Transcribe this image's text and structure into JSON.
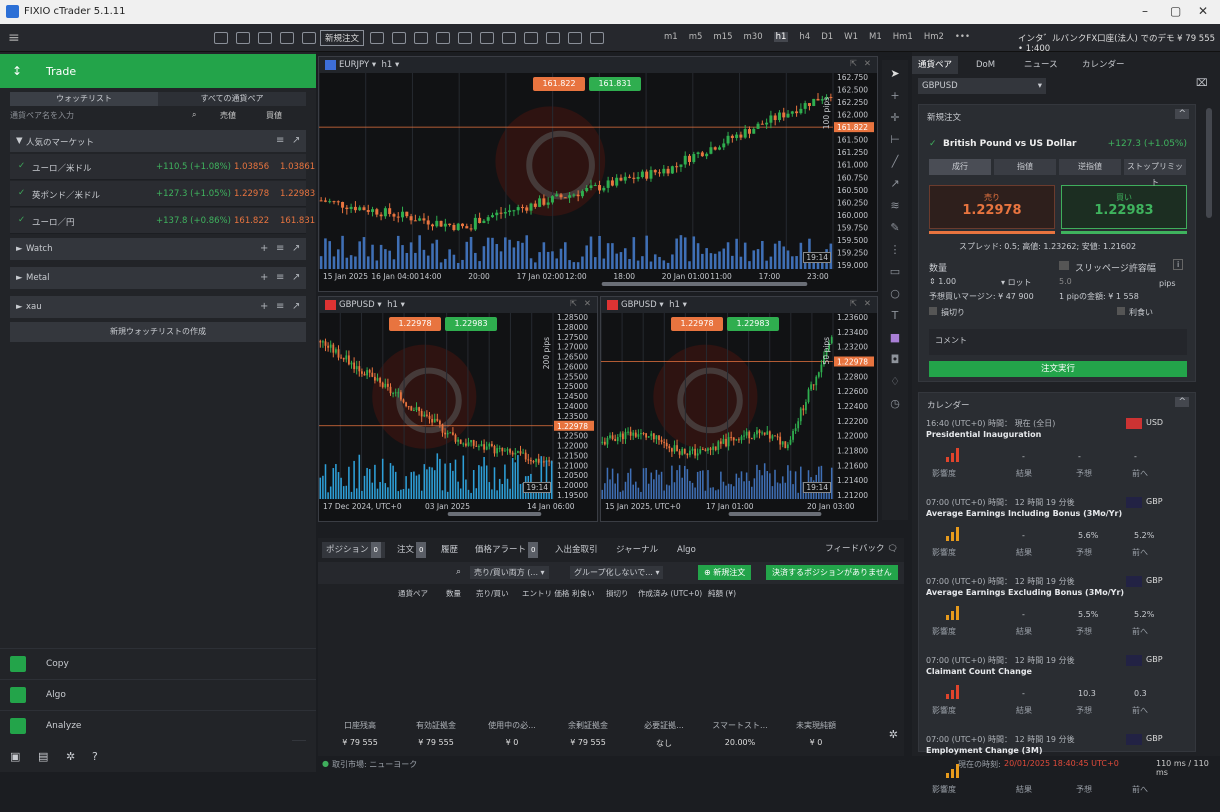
{
  "window": {
    "title": "FIXIO cTrader 5.1.11"
  },
  "toolbar": {
    "new_order": "新規注文",
    "timeframes": [
      "m1",
      "m5",
      "m15",
      "m30",
      "h1",
      "h4",
      "D1",
      "W1",
      "M1",
      "Hm1",
      "Hm2",
      "•••"
    ],
    "account_info": "インタ゛ルバンクFX口座(法人) でのデモ   ¥ 79 555 • 1:400"
  },
  "sidebar": {
    "trade_label": "Trade",
    "tabs": [
      "ウォッチリスト",
      "すべての通貨ペア"
    ],
    "search_placeholder": "通貨ペア名を入力",
    "col_bid": "売値",
    "col_ask": "買値",
    "popular": "人気のマーケット",
    "symbols": [
      {
        "name": "ユーロ／米ドル",
        "change": "+110.5 (+1.08%)",
        "bid": "1.03856",
        "ask": "1.03861"
      },
      {
        "name": "英ポンド／米ドル",
        "change": "+127.3 (+1.05%)",
        "bid": "1.22978",
        "ask": "1.22983"
      },
      {
        "name": "ユーロ／円",
        "change": "+137.8 (+0.86%)",
        "bid": "161.822",
        "ask": "161.831"
      }
    ],
    "watchlists": [
      "Watch",
      "Metal",
      "xau"
    ],
    "new_watchlist": "新規ウォッチリストの作成",
    "nav": [
      "Copy",
      "Algo",
      "Analyze"
    ]
  },
  "chart1": {
    "symbol": "EURJPY",
    "tf": "h1",
    "bid": "161.822",
    "ask": "161.831",
    "range": "100 pips",
    "prices": [
      "162.750",
      "162.500",
      "162.250",
      "162.000",
      "161.822",
      "161.500",
      "161.250",
      "161.000",
      "160.750",
      "160.500",
      "160.250",
      "160.000",
      "159.750",
      "159.500",
      "159.250",
      "159.000"
    ],
    "times": [
      "15 Jan 2025",
      "16 Jan 04:00",
      "14:00",
      "20:00",
      "17 Jan 02:00",
      "12:00",
      "18:00",
      "20 Jan 01:00",
      "11:00",
      "17:00",
      "23:00"
    ],
    "clock": "19:14"
  },
  "chart2": {
    "symbol": "GBPUSD",
    "tf": "h1",
    "bid": "1.22978",
    "ask": "1.22983",
    "range": "200 pips",
    "prices": [
      "1.28500",
      "1.28000",
      "1.27500",
      "1.27000",
      "1.26500",
      "1.26000",
      "1.25500",
      "1.25000",
      "1.24500",
      "1.24000",
      "1.23500",
      "1.22978",
      "1.22500",
      "1.22000",
      "1.21500",
      "1.21000",
      "1.20500",
      "1.20000",
      "1.19500"
    ],
    "times": [
      "17 Dec 2024, UTC+0",
      "03 Jan 2025",
      "14 Jan 06:00"
    ],
    "clock": "19:14"
  },
  "chart3": {
    "symbol": "GBPUSD",
    "tf": "h1",
    "bid": "1.22978",
    "ask": "1.22983",
    "range": "50 pips",
    "prices": [
      "1.23600",
      "1.23400",
      "1.23200",
      "1.22978",
      "1.22800",
      "1.22600",
      "1.22400",
      "1.22200",
      "1.22000",
      "1.21800",
      "1.21600",
      "1.21400",
      "1.21200"
    ],
    "times": [
      "15 Jan 2025, UTC+0",
      "17 Jan 01:00",
      "20 Jan 03:00"
    ],
    "clock": "19:14"
  },
  "bottom": {
    "tabs": [
      {
        "label": "ポジション",
        "count": "0"
      },
      {
        "label": "注文",
        "count": "0"
      },
      {
        "label": "履歴"
      },
      {
        "label": "価格アラート",
        "count": "0"
      },
      {
        "label": "入出金取引"
      },
      {
        "label": "ジャーナル"
      },
      {
        "label": "Algo"
      }
    ],
    "feedback": "フィードバック",
    "filter1": "売り/買い両方 (...",
    "filter2": "グループ化しないで...",
    "new_order": "新規注文",
    "close_none": "決済するポジションがありません",
    "columns": [
      "通貨ペア",
      "数量",
      "売り/買い",
      "エントリ 価格",
      "利食い",
      "損切り",
      "作成済み (UTC+0)",
      "純額 (¥)"
    ],
    "account": [
      {
        "label": "口座残高",
        "value": "¥ 79 555"
      },
      {
        "label": "有効証拠金",
        "value": "¥ 79 555"
      },
      {
        "label": "使用中の必...",
        "value": "¥ 0"
      },
      {
        "label": "余剰証拠金",
        "value": "¥ 79 555"
      },
      {
        "label": "必要証拠...",
        "value": "なし"
      },
      {
        "label": "スマートスト...",
        "value": "20.00%"
      },
      {
        "label": "未実現純額",
        "value": "¥ 0"
      }
    ]
  },
  "rightpanel": {
    "tabs": [
      "通貨ペア",
      "DoM",
      "ニュース",
      "カレンダー"
    ],
    "symbol": "GBPUSD",
    "new_order_title": "新規注文",
    "instrument": "British Pound vs US Dollar",
    "instrument_change": "+127.3 (+1.05%)",
    "order_types": [
      "成行",
      "指値",
      "逆指値",
      "ストップリミット"
    ],
    "sell_label": "売り",
    "sell_price": "1.22978",
    "buy_label": "買い",
    "buy_price": "1.22983",
    "spread_info": "スプレッド: 0.5; 高値: 1.23262; 安値: 1.21602",
    "qty_label": "数量",
    "slippage_label": "スリッページ許容幅",
    "qty_value": "1.00",
    "lot": "ロット",
    "slip_value": "5.0",
    "pips": "pips",
    "margin": "予想買いマージン: ¥ 47 900",
    "pip_value": "1 pipの金額: ¥ 1 558",
    "stop_loss": "損切り",
    "take_profit": "利食い",
    "comment": "コメント",
    "execute": "注文実行",
    "calendar_title": "カレンダー",
    "events": [
      {
        "time": "16:40 (UTC+0) 時間：  現在 (全日)",
        "name": "Presidential Inauguration",
        "cur": "USD",
        "actual": "-",
        "forecast": "-",
        "prev": "-"
      },
      {
        "time": "07:00 (UTC+0) 時間：  12 時間 19 分後",
        "name": "Average Earnings Including Bonus (3Mo/Yr)",
        "cur": "GBP",
        "actual": "-",
        "forecast": "5.6%",
        "prev": "5.2%"
      },
      {
        "time": "07:00 (UTC+0) 時間：  12 時間 19 分後",
        "name": "Average Earnings Excluding Bonus (3Mo/Yr)",
        "cur": "GBP",
        "actual": "-",
        "forecast": "5.5%",
        "prev": "5.2%"
      },
      {
        "time": "07:00 (UTC+0) 時間：  12 時間 19 分後",
        "name": "Claimant Count Change",
        "cur": "GBP",
        "actual": "-",
        "forecast": "10.3",
        "prev": "0.3"
      },
      {
        "time": "07:00 (UTC+0) 時間：  12 時間 19 分後",
        "name": "Employment Change (3M)",
        "cur": "GBP",
        "actual": "",
        "forecast": "",
        "prev": ""
      }
    ],
    "col_impact": "影響度",
    "col_actual": "結果",
    "col_forecast": "予想",
    "col_prev": "前へ"
  },
  "status": {
    "market": "取引市場: ニューヨーク",
    "time_label": "現在の時刻:",
    "time_value": "20/01/2025 18:40:45 UTC+0",
    "latency": "110 ms / 110 ms"
  }
}
